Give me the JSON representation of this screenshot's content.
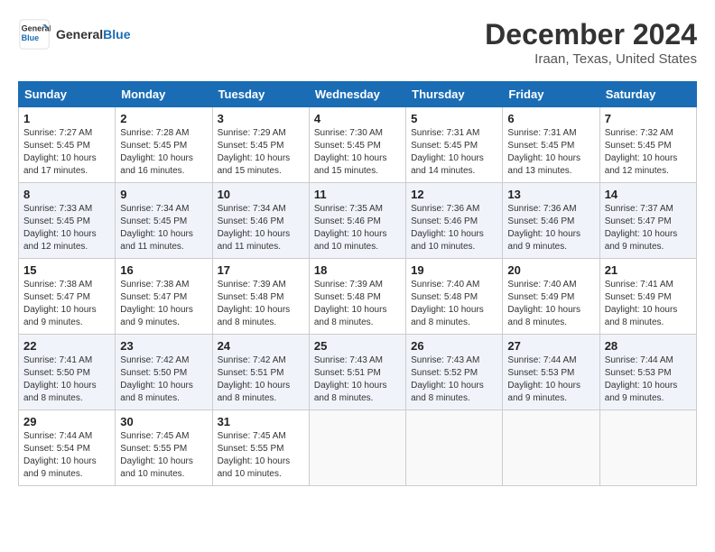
{
  "header": {
    "logo_line1": "General",
    "logo_line2": "Blue",
    "month": "December 2024",
    "location": "Iraan, Texas, United States"
  },
  "days_of_week": [
    "Sunday",
    "Monday",
    "Tuesday",
    "Wednesday",
    "Thursday",
    "Friday",
    "Saturday"
  ],
  "weeks": [
    [
      {
        "day": "1",
        "info": "Sunrise: 7:27 AM\nSunset: 5:45 PM\nDaylight: 10 hours\nand 17 minutes."
      },
      {
        "day": "2",
        "info": "Sunrise: 7:28 AM\nSunset: 5:45 PM\nDaylight: 10 hours\nand 16 minutes."
      },
      {
        "day": "3",
        "info": "Sunrise: 7:29 AM\nSunset: 5:45 PM\nDaylight: 10 hours\nand 15 minutes."
      },
      {
        "day": "4",
        "info": "Sunrise: 7:30 AM\nSunset: 5:45 PM\nDaylight: 10 hours\nand 15 minutes."
      },
      {
        "day": "5",
        "info": "Sunrise: 7:31 AM\nSunset: 5:45 PM\nDaylight: 10 hours\nand 14 minutes."
      },
      {
        "day": "6",
        "info": "Sunrise: 7:31 AM\nSunset: 5:45 PM\nDaylight: 10 hours\nand 13 minutes."
      },
      {
        "day": "7",
        "info": "Sunrise: 7:32 AM\nSunset: 5:45 PM\nDaylight: 10 hours\nand 12 minutes."
      }
    ],
    [
      {
        "day": "8",
        "info": "Sunrise: 7:33 AM\nSunset: 5:45 PM\nDaylight: 10 hours\nand 12 minutes."
      },
      {
        "day": "9",
        "info": "Sunrise: 7:34 AM\nSunset: 5:45 PM\nDaylight: 10 hours\nand 11 minutes."
      },
      {
        "day": "10",
        "info": "Sunrise: 7:34 AM\nSunset: 5:46 PM\nDaylight: 10 hours\nand 11 minutes."
      },
      {
        "day": "11",
        "info": "Sunrise: 7:35 AM\nSunset: 5:46 PM\nDaylight: 10 hours\nand 10 minutes."
      },
      {
        "day": "12",
        "info": "Sunrise: 7:36 AM\nSunset: 5:46 PM\nDaylight: 10 hours\nand 10 minutes."
      },
      {
        "day": "13",
        "info": "Sunrise: 7:36 AM\nSunset: 5:46 PM\nDaylight: 10 hours\nand 9 minutes."
      },
      {
        "day": "14",
        "info": "Sunrise: 7:37 AM\nSunset: 5:47 PM\nDaylight: 10 hours\nand 9 minutes."
      }
    ],
    [
      {
        "day": "15",
        "info": "Sunrise: 7:38 AM\nSunset: 5:47 PM\nDaylight: 10 hours\nand 9 minutes."
      },
      {
        "day": "16",
        "info": "Sunrise: 7:38 AM\nSunset: 5:47 PM\nDaylight: 10 hours\nand 9 minutes."
      },
      {
        "day": "17",
        "info": "Sunrise: 7:39 AM\nSunset: 5:48 PM\nDaylight: 10 hours\nand 8 minutes."
      },
      {
        "day": "18",
        "info": "Sunrise: 7:39 AM\nSunset: 5:48 PM\nDaylight: 10 hours\nand 8 minutes."
      },
      {
        "day": "19",
        "info": "Sunrise: 7:40 AM\nSunset: 5:48 PM\nDaylight: 10 hours\nand 8 minutes."
      },
      {
        "day": "20",
        "info": "Sunrise: 7:40 AM\nSunset: 5:49 PM\nDaylight: 10 hours\nand 8 minutes."
      },
      {
        "day": "21",
        "info": "Sunrise: 7:41 AM\nSunset: 5:49 PM\nDaylight: 10 hours\nand 8 minutes."
      }
    ],
    [
      {
        "day": "22",
        "info": "Sunrise: 7:41 AM\nSunset: 5:50 PM\nDaylight: 10 hours\nand 8 minutes."
      },
      {
        "day": "23",
        "info": "Sunrise: 7:42 AM\nSunset: 5:50 PM\nDaylight: 10 hours\nand 8 minutes."
      },
      {
        "day": "24",
        "info": "Sunrise: 7:42 AM\nSunset: 5:51 PM\nDaylight: 10 hours\nand 8 minutes."
      },
      {
        "day": "25",
        "info": "Sunrise: 7:43 AM\nSunset: 5:51 PM\nDaylight: 10 hours\nand 8 minutes."
      },
      {
        "day": "26",
        "info": "Sunrise: 7:43 AM\nSunset: 5:52 PM\nDaylight: 10 hours\nand 8 minutes."
      },
      {
        "day": "27",
        "info": "Sunrise: 7:44 AM\nSunset: 5:53 PM\nDaylight: 10 hours\nand 9 minutes."
      },
      {
        "day": "28",
        "info": "Sunrise: 7:44 AM\nSunset: 5:53 PM\nDaylight: 10 hours\nand 9 minutes."
      }
    ],
    [
      {
        "day": "29",
        "info": "Sunrise: 7:44 AM\nSunset: 5:54 PM\nDaylight: 10 hours\nand 9 minutes."
      },
      {
        "day": "30",
        "info": "Sunrise: 7:45 AM\nSunset: 5:55 PM\nDaylight: 10 hours\nand 10 minutes."
      },
      {
        "day": "31",
        "info": "Sunrise: 7:45 AM\nSunset: 5:55 PM\nDaylight: 10 hours\nand 10 minutes."
      },
      {
        "day": "",
        "info": ""
      },
      {
        "day": "",
        "info": ""
      },
      {
        "day": "",
        "info": ""
      },
      {
        "day": "",
        "info": ""
      }
    ]
  ]
}
